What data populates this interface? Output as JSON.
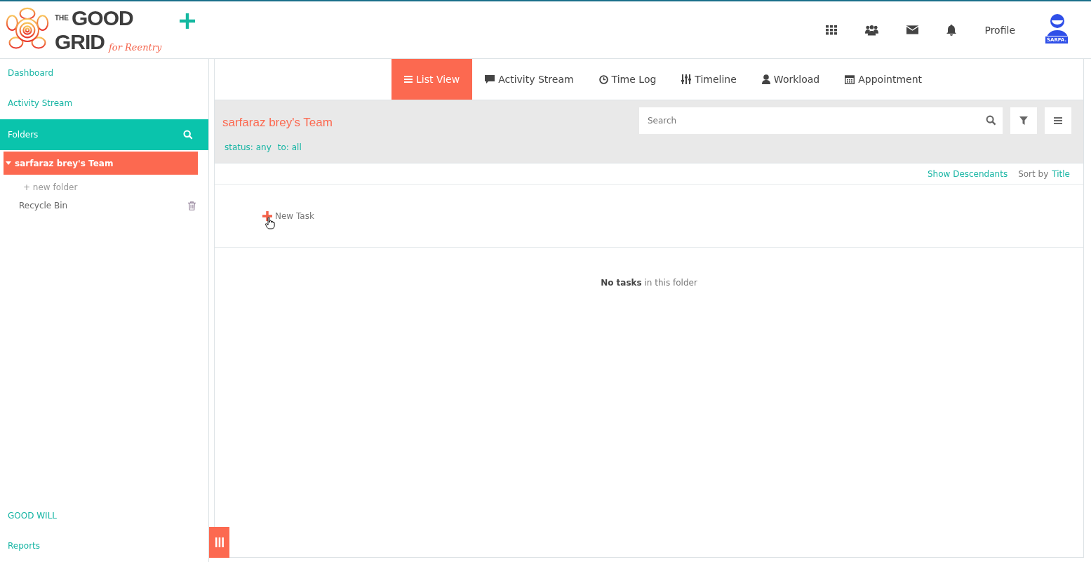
{
  "logo": {
    "top_small": "THE",
    "top": "GOOD",
    "bottom": "GRID",
    "tagline": "for Reentry"
  },
  "header": {
    "profile_label": "Profile",
    "avatar_badge": "SARFA."
  },
  "sidebar": {
    "items": [
      {
        "label": "Dashboard"
      },
      {
        "label": "Activity Stream"
      }
    ],
    "folders_label": "Folders",
    "tree": [
      {
        "label": "sarfaraz brey's Team",
        "selected": true,
        "expanded": true
      }
    ],
    "new_folder": "+ new folder",
    "recycle_bin": "Recycle Bin",
    "bottom_items": [
      {
        "label": "GOOD WILL"
      },
      {
        "label": "Reports"
      }
    ]
  },
  "tabs": [
    {
      "label": "List View",
      "selected": true
    },
    {
      "label": "Activity Stream",
      "selected": false
    },
    {
      "label": "Time Log",
      "selected": false
    },
    {
      "label": "Timeline",
      "selected": false
    },
    {
      "label": "Workload",
      "selected": false
    },
    {
      "label": "Appointment",
      "selected": false
    }
  ],
  "folder": {
    "title": "sarfaraz brey's Team",
    "filters": [
      "status: any",
      "to: all"
    ],
    "search": {
      "placeholder": "Search"
    }
  },
  "options": {
    "show_descendants": "Show Descendants",
    "sort_prefix": "Sort by",
    "sort_value": "Title"
  },
  "new_task": "New Task",
  "empty_message": "**No tasks** in this folder"
}
